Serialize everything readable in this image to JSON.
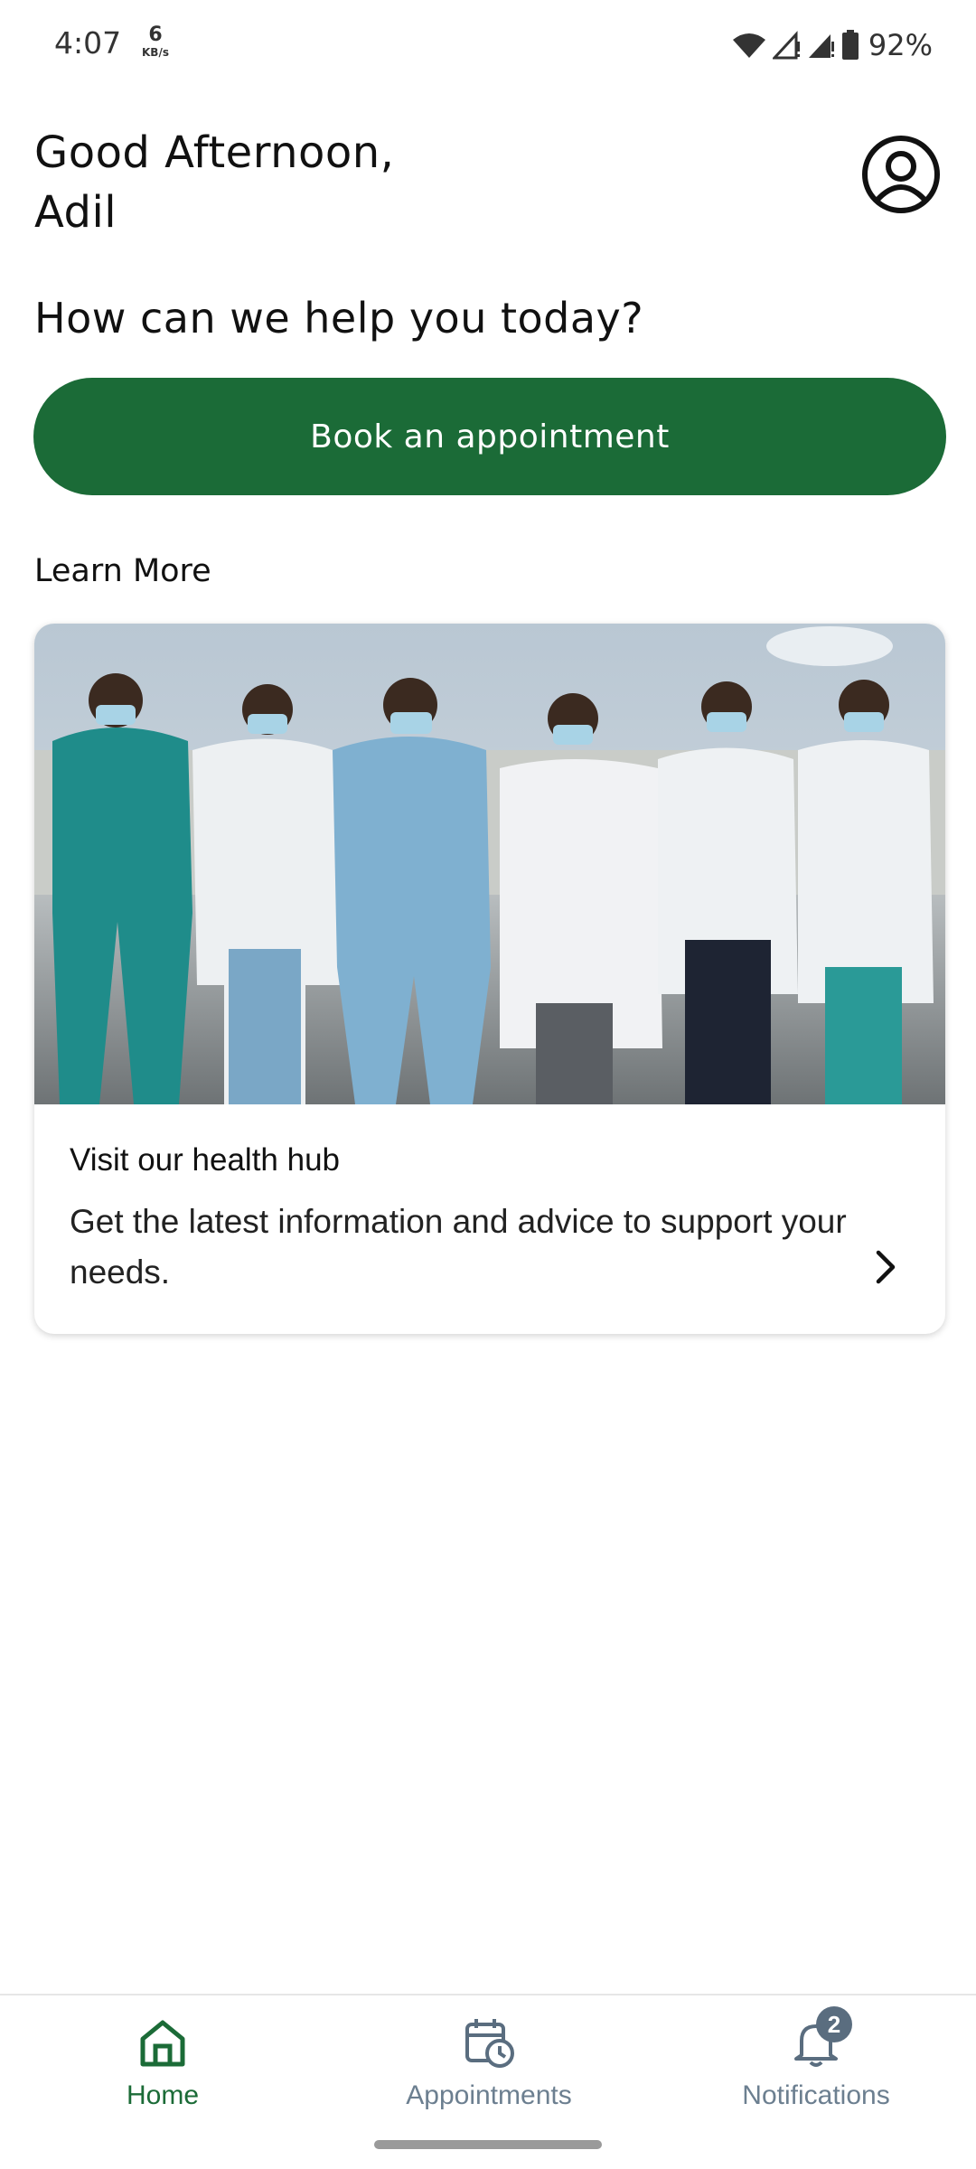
{
  "status_bar": {
    "time": "4:07",
    "net_speed_value": "6",
    "net_speed_unit": "KB/s",
    "battery": "92%",
    "icons": [
      "wifi-icon",
      "signal-icon",
      "signal-icon",
      "battery-icon"
    ]
  },
  "header": {
    "greeting_line1": "Good Afternoon,",
    "greeting_line2": "Adil",
    "profile_icon": "user-circle-icon"
  },
  "help_heading": "How can we help you today?",
  "primary_action": {
    "label": "Book an appointment",
    "color": "#1b6b37"
  },
  "learn_more": {
    "heading": "Learn More",
    "card": {
      "image": "photo of six masked healthcare workers",
      "title": "Visit our health hub",
      "body": "Get the latest information and advice to support your needs.",
      "arrow_icon": "chevron-right-icon"
    }
  },
  "bottom_nav": {
    "items": [
      {
        "label": "Home",
        "icon": "home-icon",
        "active": true
      },
      {
        "label": "Appointments",
        "icon": "calendar-clock-icon",
        "active": false
      },
      {
        "label": "Notifications",
        "icon": "bell-icon",
        "active": false,
        "badge": "2"
      }
    ],
    "active_color": "#1b6b37",
    "inactive_color": "#6c7f90"
  }
}
